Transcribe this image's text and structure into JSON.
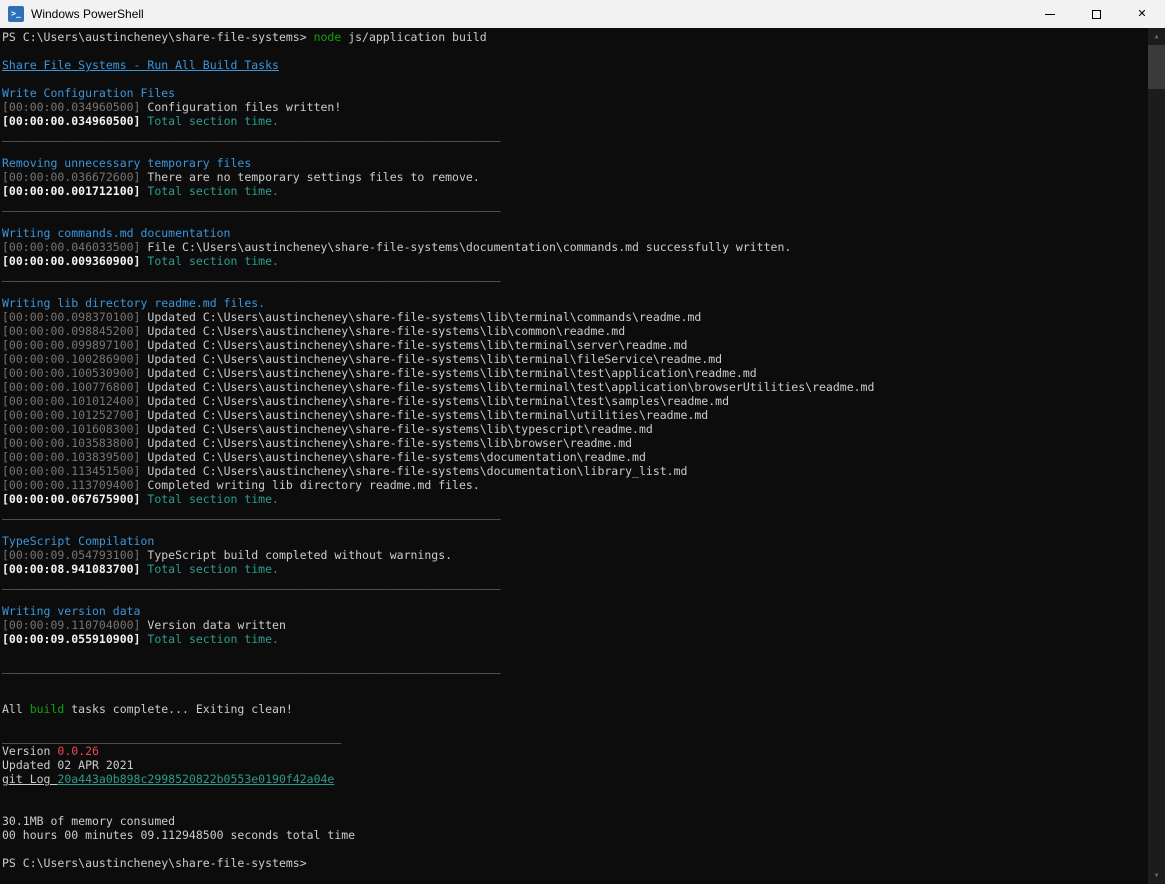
{
  "window": {
    "title": "Windows PowerShell",
    "controls": [
      "minimize",
      "maximize",
      "close"
    ]
  },
  "palette": {
    "background": "#0C0C0C",
    "foreground": "#CCCCCC",
    "dim_timestamp": "#767676",
    "bright_timestamp": "#F2F2F2",
    "heading_cyan": "#3A96DD",
    "section_teal": "#2C9C8F",
    "green": "#13A10E",
    "red": "#E74856",
    "titlebar": "#F2F2F2"
  },
  "terminal": {
    "rows": [
      [
        {
          "t": "PS C:\\Users\\austincheney\\share-file-systems> ",
          "s": "fg"
        },
        {
          "t": "node",
          "s": "green"
        },
        {
          "t": " js/application build",
          "s": "fg"
        }
      ],
      [],
      [
        {
          "t": "Share File Systems - Run All Build Tasks",
          "s": "headu",
          "n": "build-tasks-heading-link"
        }
      ],
      [],
      [
        {
          "t": "Write Configuration Files",
          "s": "head",
          "n": "section-heading"
        }
      ],
      [
        {
          "t": "[00:00:00.034960500]",
          "s": "dim"
        },
        {
          "t": " Configuration files written!",
          "s": "fg"
        }
      ],
      [
        {
          "t": "[00:00:00.034960500]",
          "s": "bright"
        },
        {
          "t": " Total section time.",
          "s": "teal"
        }
      ],
      [
        {
          "t": "________________________________________________________________________",
          "s": "sep",
          "n": "section-separator"
        }
      ],
      [],
      [
        {
          "t": "Removing unnecessary temporary files",
          "s": "head",
          "n": "section-heading"
        }
      ],
      [
        {
          "t": "[00:00:00.036672600]",
          "s": "dim"
        },
        {
          "t": " There are no temporary settings files to remove.",
          "s": "fg"
        }
      ],
      [
        {
          "t": "[00:00:00.001712100]",
          "s": "bright"
        },
        {
          "t": " Total section time.",
          "s": "teal"
        }
      ],
      [
        {
          "t": "________________________________________________________________________",
          "s": "sep",
          "n": "section-separator"
        }
      ],
      [],
      [
        {
          "t": "Writing commands.md documentation",
          "s": "head",
          "n": "section-heading"
        }
      ],
      [
        {
          "t": "[00:00:00.046033500]",
          "s": "dim"
        },
        {
          "t": " File C:\\Users\\austincheney\\share-file-systems\\documentation\\commands.md successfully written.",
          "s": "fg"
        }
      ],
      [
        {
          "t": "[00:00:00.009360900]",
          "s": "bright"
        },
        {
          "t": " Total section time.",
          "s": "teal"
        }
      ],
      [
        {
          "t": "________________________________________________________________________",
          "s": "sep",
          "n": "section-separator"
        }
      ],
      [],
      [
        {
          "t": "Writing lib directory readme.md files.",
          "s": "head",
          "n": "section-heading"
        }
      ],
      [
        {
          "t": "[00:00:00.098370100]",
          "s": "dim"
        },
        {
          "t": " Updated C:\\Users\\austincheney\\share-file-systems\\lib\\terminal\\commands\\readme.md",
          "s": "fg"
        }
      ],
      [
        {
          "t": "[00:00:00.098845200]",
          "s": "dim"
        },
        {
          "t": " Updated C:\\Users\\austincheney\\share-file-systems\\lib\\common\\readme.md",
          "s": "fg"
        }
      ],
      [
        {
          "t": "[00:00:00.099897100]",
          "s": "dim"
        },
        {
          "t": " Updated C:\\Users\\austincheney\\share-file-systems\\lib\\terminal\\server\\readme.md",
          "s": "fg"
        }
      ],
      [
        {
          "t": "[00:00:00.100286900]",
          "s": "dim"
        },
        {
          "t": " Updated C:\\Users\\austincheney\\share-file-systems\\lib\\terminal\\fileService\\readme.md",
          "s": "fg"
        }
      ],
      [
        {
          "t": "[00:00:00.100530900]",
          "s": "dim"
        },
        {
          "t": " Updated C:\\Users\\austincheney\\share-file-systems\\lib\\terminal\\test\\application\\readme.md",
          "s": "fg"
        }
      ],
      [
        {
          "t": "[00:00:00.100776800]",
          "s": "dim"
        },
        {
          "t": " Updated C:\\Users\\austincheney\\share-file-systems\\lib\\terminal\\test\\application\\browserUtilities\\readme.md",
          "s": "fg"
        }
      ],
      [
        {
          "t": "[00:00:00.101012400]",
          "s": "dim"
        },
        {
          "t": " Updated C:\\Users\\austincheney\\share-file-systems\\lib\\terminal\\test\\samples\\readme.md",
          "s": "fg"
        }
      ],
      [
        {
          "t": "[00:00:00.101252700]",
          "s": "dim"
        },
        {
          "t": " Updated C:\\Users\\austincheney\\share-file-systems\\lib\\terminal\\utilities\\readme.md",
          "s": "fg"
        }
      ],
      [
        {
          "t": "[00:00:00.101608300]",
          "s": "dim"
        },
        {
          "t": " Updated C:\\Users\\austincheney\\share-file-systems\\lib\\typescript\\readme.md",
          "s": "fg"
        }
      ],
      [
        {
          "t": "[00:00:00.103583800]",
          "s": "dim"
        },
        {
          "t": " Updated C:\\Users\\austincheney\\share-file-systems\\lib\\browser\\readme.md",
          "s": "fg"
        }
      ],
      [
        {
          "t": "[00:00:00.103839500]",
          "s": "dim"
        },
        {
          "t": " Updated C:\\Users\\austincheney\\share-file-systems\\documentation\\readme.md",
          "s": "fg"
        }
      ],
      [
        {
          "t": "[00:00:00.113451500]",
          "s": "dim"
        },
        {
          "t": " Updated C:\\Users\\austincheney\\share-file-systems\\documentation\\library_list.md",
          "s": "fg"
        }
      ],
      [
        {
          "t": "[00:00:00.113709400]",
          "s": "dim"
        },
        {
          "t": " Completed writing lib directory readme.md files.",
          "s": "fg"
        }
      ],
      [
        {
          "t": "[00:00:00.067675900]",
          "s": "bright"
        },
        {
          "t": " Total section time.",
          "s": "teal"
        }
      ],
      [
        {
          "t": "________________________________________________________________________",
          "s": "sep",
          "n": "section-separator"
        }
      ],
      [],
      [
        {
          "t": "TypeScript Compilation",
          "s": "head",
          "n": "section-heading"
        }
      ],
      [
        {
          "t": "[00:00:09.054793100]",
          "s": "dim"
        },
        {
          "t": " TypeScript build completed without warnings.",
          "s": "fg"
        }
      ],
      [
        {
          "t": "[00:00:08.941083700]",
          "s": "bright"
        },
        {
          "t": " Total section time.",
          "s": "teal"
        }
      ],
      [
        {
          "t": "________________________________________________________________________",
          "s": "sep",
          "n": "section-separator"
        }
      ],
      [],
      [
        {
          "t": "Writing version data",
          "s": "head",
          "n": "section-heading"
        }
      ],
      [
        {
          "t": "[00:00:09.110704000]",
          "s": "dim"
        },
        {
          "t": " Version data written",
          "s": "fg"
        }
      ],
      [
        {
          "t": "[00:00:09.055910900]",
          "s": "bright"
        },
        {
          "t": " Total section time.",
          "s": "teal"
        }
      ],
      [],
      [
        {
          "t": "________________________________________________________________________",
          "s": "sep",
          "n": "section-separator"
        }
      ],
      [],
      [],
      [
        {
          "t": "All ",
          "s": "fg"
        },
        {
          "t": "build",
          "s": "green"
        },
        {
          "t": " tasks complete... Exiting clean!",
          "s": "fg"
        }
      ],
      [],
      [
        {
          "t": "_________________________________________________",
          "s": "sep",
          "n": "summary-separator"
        }
      ],
      [
        {
          "t": "Version ",
          "s": "fg"
        },
        {
          "t": "0.0.26",
          "s": "red",
          "n": "version-number"
        }
      ],
      [
        {
          "t": "Updated 02 APR 2021",
          "s": "fg",
          "n": "updated-date"
        }
      ],
      [
        {
          "t": "git Log ",
          "s": "fgu"
        },
        {
          "t": "20a443a0b898c2998520822b0553e0190f42a04e",
          "s": "tealu",
          "n": "git-log-hash"
        }
      ],
      [],
      [],
      [
        {
          "t": "30.1MB of memory consumed",
          "s": "fg",
          "n": "memory-consumed"
        }
      ],
      [
        {
          "t": "00 hours 00 minutes 09.112948500 seconds total time",
          "s": "fg",
          "n": "total-time"
        }
      ],
      [],
      [
        {
          "t": "PS C:\\Users\\austincheney\\share-file-systems>",
          "s": "fg",
          "n": "shell-prompt"
        }
      ]
    ]
  }
}
